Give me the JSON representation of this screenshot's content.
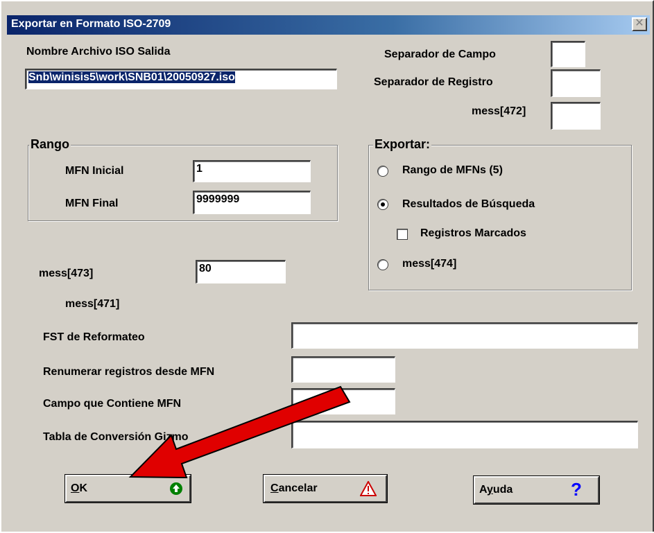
{
  "window": {
    "title": "Exportar en Formato ISO-2709",
    "close_glyph": "✕"
  },
  "output_file": {
    "label": "Nombre Archivo ISO Salida",
    "value": "Snb\\winisis5\\work\\SNB01\\20050927.iso"
  },
  "separators": {
    "field_label": "Separador de Campo",
    "field_value": "",
    "record_label": "Separador de Registro",
    "record_value": "",
    "mess472_label": "mess[472]",
    "mess472_value": ""
  },
  "range": {
    "title": "Rango",
    "mfn_start_label": "MFN Inicial",
    "mfn_start_value": "1",
    "mfn_end_label": "MFN Final",
    "mfn_end_value": "9999999"
  },
  "export": {
    "title": "Exportar:",
    "option_range": "Rango de MFNs (5)",
    "option_search": "Resultados de Búsqueda",
    "marked_records": "Registros Marcados",
    "option_mess474": "mess[474]",
    "selected": "option_search"
  },
  "mess473": {
    "label": "mess[473]",
    "value": "80"
  },
  "mess471": {
    "label": "mess[471]"
  },
  "reformat_fst": {
    "label": "FST de Reformateo",
    "value": ""
  },
  "renumber": {
    "label": "Renumerar registros desde MFN",
    "value": ""
  },
  "mfn_field": {
    "label": "Campo que Contiene MFN",
    "value": ""
  },
  "conversion_table": {
    "label": "Tabla de Conversión Gizmo",
    "value": ""
  },
  "buttons": {
    "ok_underlined": "O",
    "ok_rest": "K",
    "cancel_underlined": "C",
    "cancel_rest": "ancelar",
    "help_prefix": "A",
    "help_underlined": "y",
    "help_rest": "uda",
    "help_glyph": "?"
  },
  "colors": {
    "title_bar": "#0a246a",
    "ok_icon": "#008000",
    "cancel_icon": "#cc0000",
    "help_icon": "#0000ff",
    "arrow": "#e00000"
  }
}
